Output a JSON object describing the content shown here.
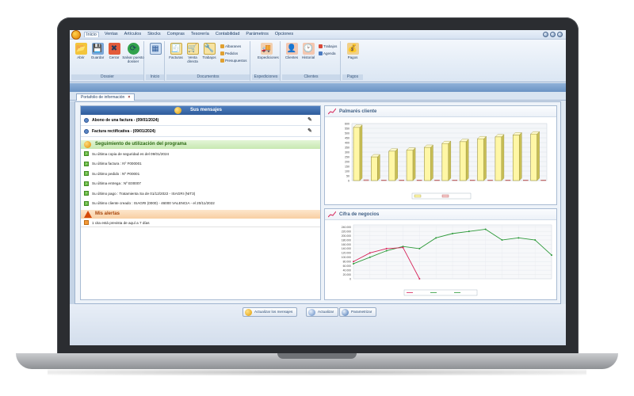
{
  "app": {
    "menu": [
      "Inicio",
      "Ventas",
      "Artículos",
      "Stocks",
      "Compras",
      "Tesorería",
      "Contabilidad",
      "Parámetros",
      "Opciones"
    ],
    "menu_active_index": 0
  },
  "ribbon": {
    "groups": [
      {
        "label": "Dossier",
        "buttons": [
          "Abrir",
          "Guardar",
          "Cerrar",
          "Salvar puesto dossier"
        ]
      },
      {
        "label": "Inicio",
        "buttons": [
          ""
        ]
      },
      {
        "label": "Documentos",
        "buttons": [
          "Facturas",
          "Venta directa",
          "Trabajos"
        ],
        "small_items": [
          "Albaranes",
          "Pedidos",
          "Presupuestos"
        ]
      },
      {
        "label": "Expediciones",
        "buttons": [
          "Expediciones"
        ]
      },
      {
        "label": "Clientes",
        "buttons": [
          "Clientes",
          "Historial"
        ],
        "small_items": [
          "Trabajos",
          "Agenda"
        ]
      },
      {
        "label": "Pagos",
        "buttons": [
          "Pagos"
        ]
      }
    ]
  },
  "document_tab": {
    "label": "Portafolio de información",
    "close": "×"
  },
  "messages": {
    "title": "Sus mensajes",
    "items": [
      "Abono de una factura - (09/01/2024)",
      "Factura rectificativa - (09/01/2024)"
    ]
  },
  "tracking": {
    "title": "Seguimiento de utilización del programa",
    "items": [
      "Su última copia de seguridad es del 09/01/2024",
      "Su última factura : Nº F000001",
      "Su último pedido : Nº P00001",
      "Su última entrega : Nº E00007",
      "Su último pago : Tratamienta Sa de 01/12/2022 - ISAGRI (NIT3)",
      "Su último cliente creado : ISAGRI (0000) - 46000 VALENCIA - el 20/11/2022"
    ]
  },
  "alerts": {
    "title": "Mis alertas",
    "items": [
      "1 cita está prevista de aquí a 7 días"
    ]
  },
  "bottom_buttons": [
    "Actualizar los mensajes",
    "Actualizar",
    "Parametrizar"
  ],
  "colors": {
    "accent": "#2f5c9b",
    "green": "#2b6a12",
    "orange": "#a8450a",
    "bar_yellow": "#fff7a6",
    "line_green": "#2e9a3a",
    "line_red": "#d6245a"
  },
  "chart_data": [
    {
      "type": "bar",
      "title": "Palmarés cliente",
      "ylabel": "",
      "ylim": [
        0,
        600
      ],
      "yticks": [
        0,
        50,
        100,
        150,
        200,
        250,
        300,
        350,
        400,
        450,
        500,
        550,
        600
      ],
      "categories": [
        "",
        "",
        "",
        "",
        "",
        "",
        "",
        "",
        "",
        "",
        ""
      ],
      "series": [
        {
          "name": "",
          "values": [
            560,
            250,
            310,
            320,
            350,
            390,
            410,
            440,
            460,
            480,
            490
          ]
        },
        {
          "name": "",
          "values": [
            8,
            6,
            6,
            6,
            6,
            6,
            6,
            6,
            6,
            6,
            6
          ]
        }
      ],
      "grid": true,
      "legend": "bottom"
    },
    {
      "type": "line",
      "title": "Cifra de negocios",
      "ylabel": "",
      "xlabel": "",
      "ylim": [
        0,
        250000
      ],
      "yticks": [
        0,
        20000,
        40000,
        60000,
        80000,
        100000,
        120000,
        140000,
        160000,
        180000,
        200000,
        220000,
        240000
      ],
      "categories": [
        "",
        "",
        "",
        "",
        "",
        "",
        "",
        "",
        "",
        "",
        "",
        "",
        ""
      ],
      "series": [
        {
          "name": "",
          "values": [
            70000,
            100000,
            130000,
            150000,
            140000,
            190000,
            210000,
            220000,
            230000,
            180000,
            190000,
            180000,
            110000
          ]
        },
        {
          "name": "",
          "values": [
            80000,
            120000,
            140000,
            145000,
            0,
            null,
            null,
            null,
            null,
            null,
            null,
            null,
            null
          ]
        }
      ],
      "grid": true,
      "legend": "bottom"
    }
  ]
}
